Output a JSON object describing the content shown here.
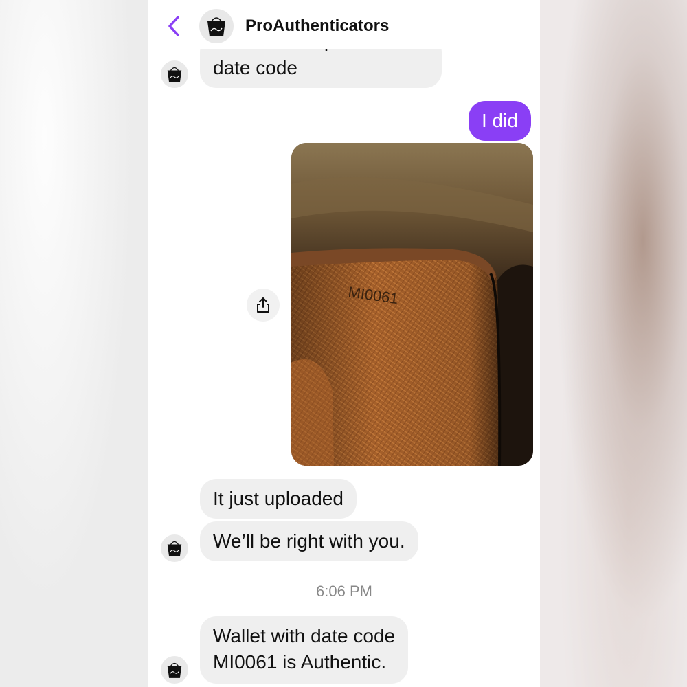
{
  "header": {
    "back_icon": "chevron-left-icon",
    "avatar_icon": "handbag-logo-icon",
    "title": "ProAuthenticators",
    "accent_color": "#8a3ff5"
  },
  "messages": [
    {
      "side": "incoming",
      "partial_text": "Please send picture of",
      "text": "date code"
    },
    {
      "side": "outgoing",
      "text": "I did"
    },
    {
      "side": "outgoing",
      "type": "photo",
      "photo_text": "MI0061"
    },
    {
      "side": "incoming",
      "text": "It just uploaded"
    },
    {
      "side": "incoming",
      "text": "We’ll be right with you."
    },
    {
      "side": "incoming",
      "text": "Wallet with date code",
      "text_line2": "MI0061 is Authentic."
    }
  ],
  "timestamp": "6:06 PM",
  "share_icon": "share-icon"
}
